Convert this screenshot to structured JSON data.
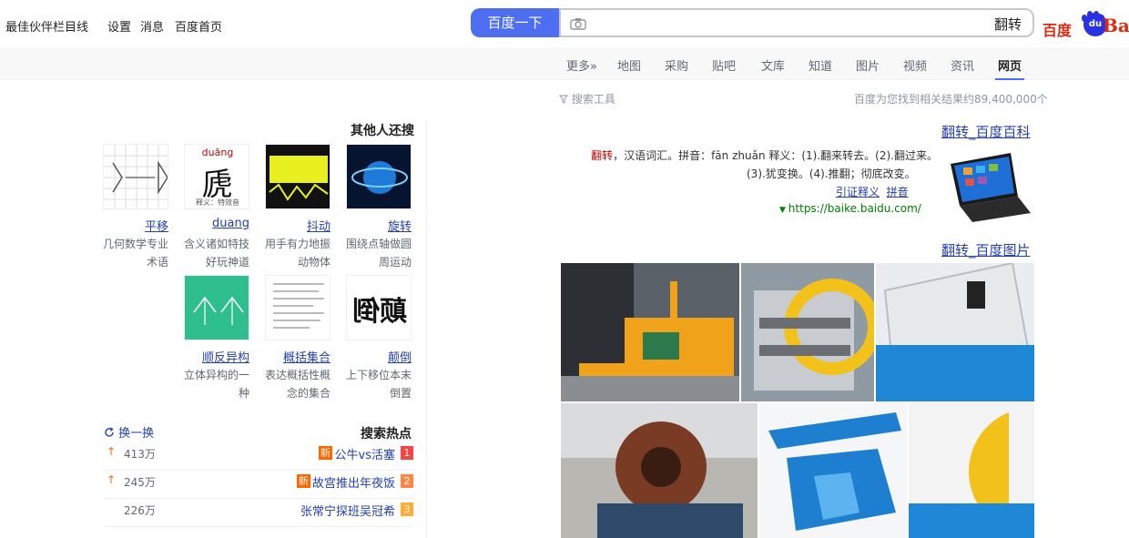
{
  "header": {
    "logo_cn": "百度",
    "logo_bai": "Bai",
    "logo_du": "du",
    "query": "翻转",
    "search_button": "百度一下",
    "links": [
      "百度首页",
      "消息",
      "设置",
      "最佳伙伴栏目线"
    ]
  },
  "nav": {
    "tabs": [
      "网页",
      "资讯",
      "视频",
      "图片",
      "知道",
      "文库",
      "贴吧",
      "采购",
      "地图",
      "更多»"
    ]
  },
  "result_count": "百度为您找到相关结果约89,400,000个",
  "tools": "搜索工具",
  "results": {
    "baike": {
      "title": "翻转_百度百科",
      "line1_em": "翻转",
      "line1": "，汉语词汇。拼音：fān zhuǎn 释义：(1).翻来转去。(2).翻过来。",
      "line2": "(3).犹变换。(4).推翻；彻底改变。",
      "link1": "拼音",
      "link2": "引证释义",
      "url": "https://baike.baidu.com/"
    },
    "images_title": "翻转_百度图片"
  },
  "sidebar": {
    "title": "其他人还搜",
    "items": [
      {
        "name": "旋转",
        "desc": "围绕点轴做圆周运动"
      },
      {
        "name": "抖动",
        "desc": "用手有力地振动物体"
      },
      {
        "name": "duang",
        "desc": "含义诸如特技好玩神道"
      },
      {
        "name": "平移",
        "desc": "几何数学专业术语"
      },
      {
        "name": "颠倒",
        "desc": "上下移位本末倒置"
      },
      {
        "name": "概括集合",
        "desc": "表达概括性概念的集合"
      },
      {
        "name": "顺反异构",
        "desc": "立体异构的一种"
      }
    ],
    "thumb_duang_top": "duāng",
    "thumb_duang_char": "虒",
    "thumb_duang_note": "释义：特效音",
    "thumb_diandao": "颠倒",
    "hot_title": "搜索热点",
    "refresh": "换一换",
    "hot": [
      {
        "rank": "1",
        "text": "公牛vs活塞",
        "new": "新",
        "count": "413万"
      },
      {
        "rank": "2",
        "text": "故宫推出年夜饭",
        "new": "新",
        "count": "245万"
      },
      {
        "rank": "3",
        "text": "张常宁探班吴冠希",
        "new": "",
        "count": "226万"
      }
    ]
  },
  "colors": {
    "brand_blue": "#4e6ef2",
    "link_blue": "#2440b3",
    "hot_red": "#f54545",
    "hot_orange": "#ff8547",
    "hot_yellow": "#ffac38"
  }
}
